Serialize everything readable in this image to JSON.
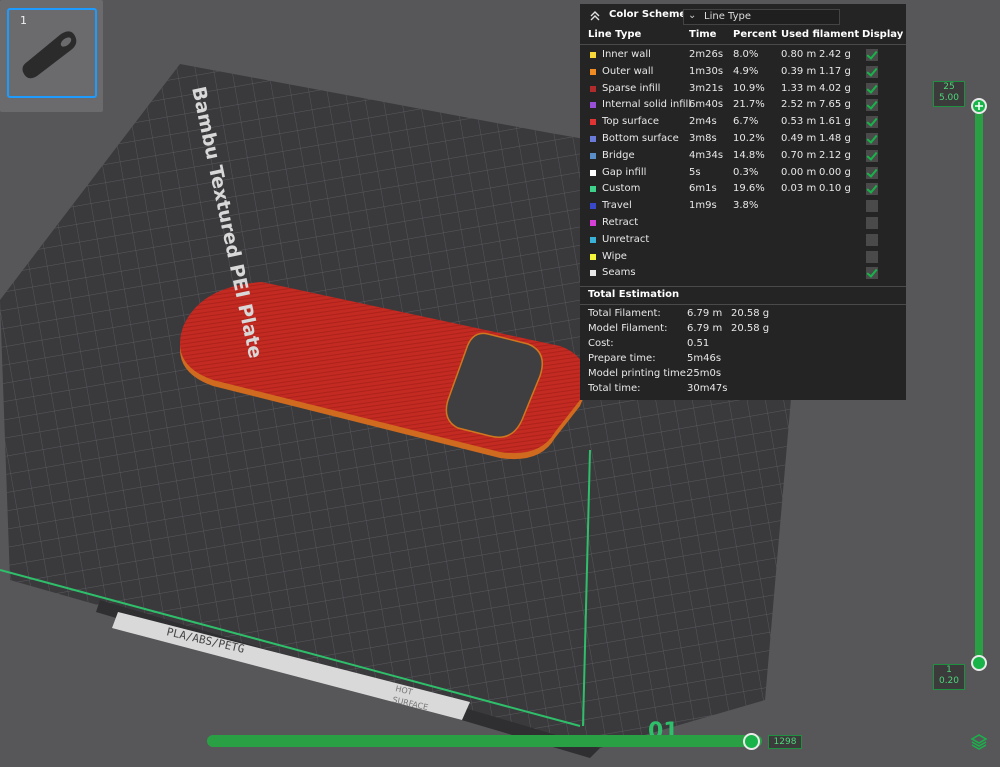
{
  "plate": {
    "thumbnail_number": "1",
    "bed_title": "Bambu Textured PEI Plate",
    "bed_material_text": "PLA/ABS/PETG",
    "bed_hot_surface_line1": "HOT",
    "bed_hot_surface_line2": "SURFACE",
    "bed_plate_id": "01"
  },
  "legend": {
    "color_scheme_label": "Color Scheme",
    "color_scheme_value": "Line Type",
    "columns": [
      "Line Type",
      "Time",
      "Percent",
      "Used filament",
      "Display"
    ],
    "rows": [
      {
        "name": "Inner wall",
        "color": "#f5d73a",
        "time": "2m26s",
        "percent": "8.0%",
        "length": "0.80 m",
        "weight": "2.42 g",
        "display": true
      },
      {
        "name": "Outer wall",
        "color": "#f08a22",
        "time": "1m30s",
        "percent": "4.9%",
        "length": "0.39 m",
        "weight": "1.17 g",
        "display": true
      },
      {
        "name": "Sparse infill",
        "color": "#b02b2b",
        "time": "3m21s",
        "percent": "10.9%",
        "length": "1.33 m",
        "weight": "4.02 g",
        "display": true
      },
      {
        "name": "Internal solid infill",
        "color": "#9a4fd8",
        "time": "6m40s",
        "percent": "21.7%",
        "length": "2.52 m",
        "weight": "7.65 g",
        "display": true
      },
      {
        "name": "Top surface",
        "color": "#e03434",
        "time": "2m4s",
        "percent": "6.7%",
        "length": "0.53 m",
        "weight": "1.61 g",
        "display": true
      },
      {
        "name": "Bottom surface",
        "color": "#6a7ad8",
        "time": "3m8s",
        "percent": "10.2%",
        "length": "0.49 m",
        "weight": "1.48 g",
        "display": true
      },
      {
        "name": "Bridge",
        "color": "#5a8ec8",
        "time": "4m34s",
        "percent": "14.8%",
        "length": "0.70 m",
        "weight": "2.12 g",
        "display": true
      },
      {
        "name": "Gap infill",
        "color": "#ffffff",
        "time": "5s",
        "percent": "0.3%",
        "length": "0.00 m",
        "weight": "0.00 g",
        "display": true
      },
      {
        "name": "Custom",
        "color": "#3ed18a",
        "time": "6m1s",
        "percent": "19.6%",
        "length": "0.03 m",
        "weight": "0.10 g",
        "display": true
      },
      {
        "name": "Travel",
        "color": "#3848c8",
        "time": "1m9s",
        "percent": "3.8%",
        "length": "",
        "weight": "",
        "display": false
      },
      {
        "name": "Retract",
        "color": "#d640d6",
        "time": "",
        "percent": "",
        "length": "",
        "weight": "",
        "display": false
      },
      {
        "name": "Unretract",
        "color": "#3ab2d8",
        "time": "",
        "percent": "",
        "length": "",
        "weight": "",
        "display": false
      },
      {
        "name": "Wipe",
        "color": "#f5f53a",
        "time": "",
        "percent": "",
        "length": "",
        "weight": "",
        "display": false
      },
      {
        "name": "Seams",
        "color": "#e8e8e8",
        "time": "",
        "percent": "",
        "length": "",
        "weight": "",
        "display": true
      }
    ],
    "total_title": "Total Estimation",
    "totals": [
      {
        "label": "Total Filament:",
        "v1": "6.79 m",
        "v2": "20.58 g"
      },
      {
        "label": "Model Filament:",
        "v1": "6.79 m",
        "v2": "20.58 g"
      },
      {
        "label": "Cost:",
        "v1": "0.51",
        "v2": ""
      },
      {
        "label": "Prepare time:",
        "v1": "5m46s",
        "v2": ""
      },
      {
        "label": "Model printing time:",
        "v1": "25m0s",
        "v2": ""
      },
      {
        "label": "Total time:",
        "v1": "30m47s",
        "v2": ""
      }
    ]
  },
  "layer_slider": {
    "top_layer": "25",
    "top_height": "5.00",
    "bottom_layer": "1",
    "bottom_height": "0.20"
  },
  "move_slider": {
    "value": "1298"
  },
  "colors": {
    "accent": "#18b44a",
    "part": "#c42b22",
    "edge": "#d26a1e",
    "panel": "#242424"
  }
}
